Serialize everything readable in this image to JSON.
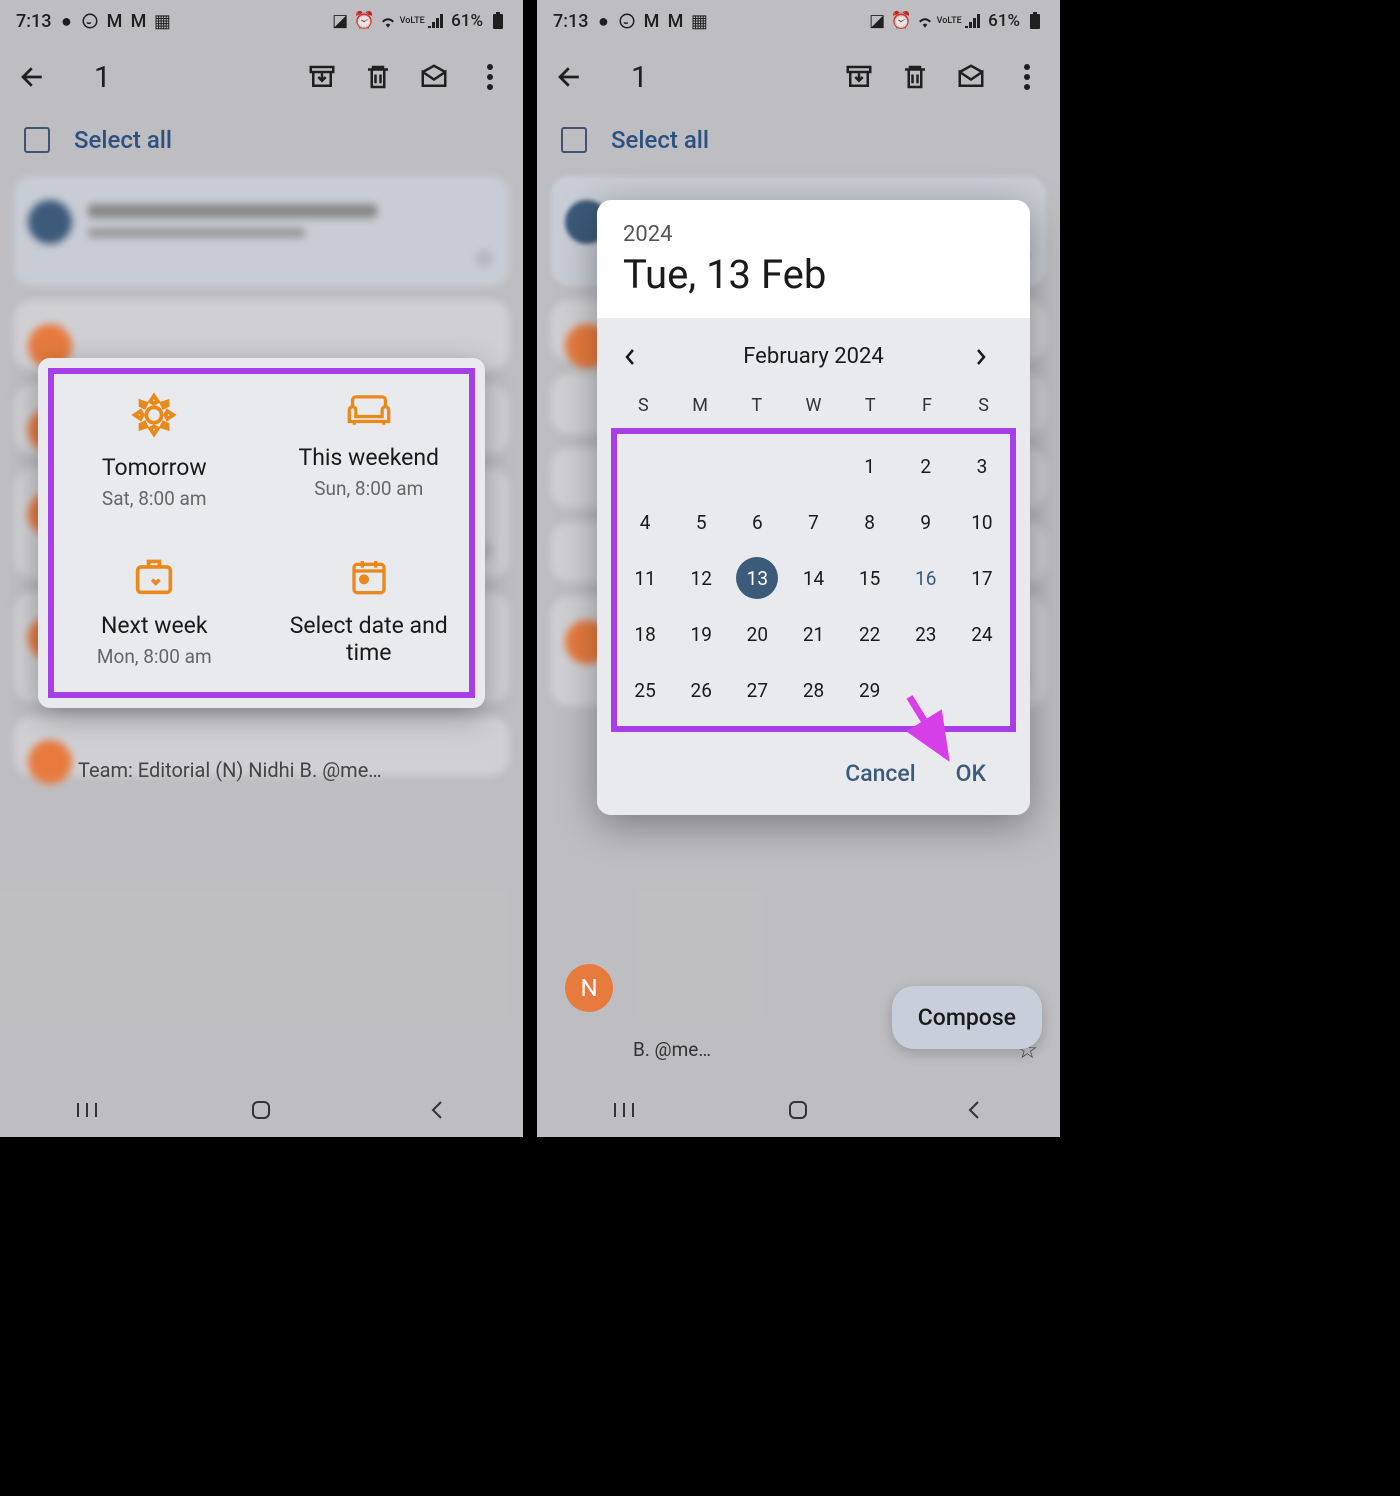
{
  "status": {
    "time": "7:13",
    "battery_pct": "61%"
  },
  "appbar": {
    "selected_count": "1"
  },
  "select_all_label": "Select all",
  "teaser": "Team: Editorial (N) Nidhi B. @me…",
  "snooze": {
    "tomorrow": {
      "title": "Tomorrow",
      "sub": "Sat, 8:00 am"
    },
    "weekend": {
      "title": "This weekend",
      "sub": "Sun, 8:00 am"
    },
    "nextweek": {
      "title": "Next week",
      "sub": "Mon, 8:00 am"
    },
    "custom": {
      "title": "Select date and time",
      "sub": ""
    }
  },
  "datepicker": {
    "year": "2024",
    "full": "Tue, 13 Feb",
    "month_label": "February 2024",
    "dow": [
      "S",
      "M",
      "T",
      "W",
      "T",
      "F",
      "S"
    ],
    "days": [
      "",
      "",
      "",
      "",
      "1",
      "2",
      "3",
      "4",
      "5",
      "6",
      "7",
      "8",
      "9",
      "10",
      "11",
      "12",
      "13",
      "14",
      "15",
      "16",
      "17",
      "18",
      "19",
      "20",
      "21",
      "22",
      "23",
      "24",
      "25",
      "26",
      "27",
      "28",
      "29",
      "",
      ""
    ],
    "selected_day": "13",
    "today": "16",
    "cancel": "Cancel",
    "ok": "OK"
  },
  "compose_label": "Compose",
  "avatar_letter": "N",
  "snippet": "B. @me…"
}
